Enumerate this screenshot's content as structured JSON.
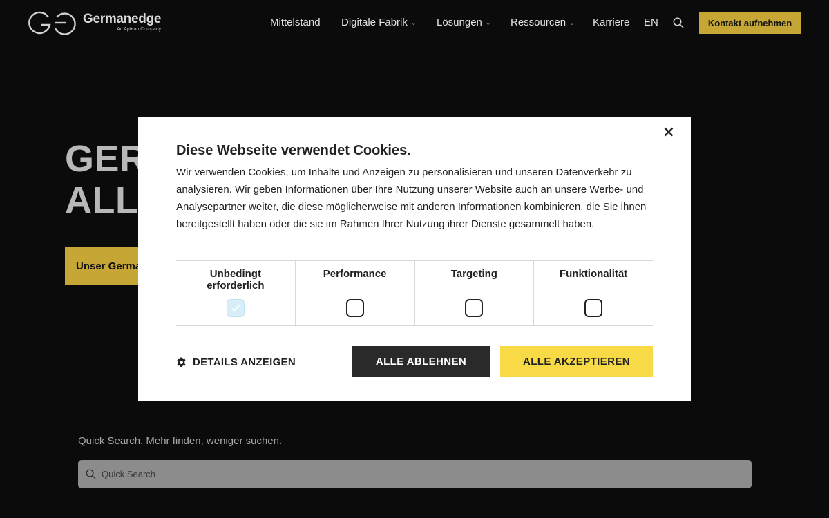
{
  "header": {
    "brand_name": "Germanedge",
    "brand_sub": "An Aptean Company",
    "nav": [
      {
        "label": "Mittelstand",
        "dropdown": false
      },
      {
        "label": "Digitale Fabrik",
        "dropdown": true
      },
      {
        "label": "Lösungen",
        "dropdown": true
      },
      {
        "label": "Ressourcen",
        "dropdown": true
      },
      {
        "label": "Karriere",
        "dropdown": false
      },
      {
        "label": "EN",
        "dropdown": false
      }
    ],
    "contact_label": "Kontakt aufnehmen",
    "accent_color": "#c6a634"
  },
  "hero": {
    "line1": "GER",
    "line2": "ALL",
    "button_label": "Unser Germa"
  },
  "quick_search": {
    "label": "Quick Search. Mehr finden, weniger suchen.",
    "placeholder": "Quick Search"
  },
  "cookie_modal": {
    "title": "Diese Webseite verwendet Cookies.",
    "body": "Wir verwenden Cookies, um Inhalte und Anzeigen zu personalisieren und unseren Datenverkehr zu analysieren. Wir geben Informationen über Ihre Nutzung unserer Website auch an unsere Werbe- und Analysepartner weiter, die diese möglicherweise mit anderen Informationen kombinieren, die Sie ihnen bereitgestellt haben oder die sie im Rahmen Ihrer Nutzung ihrer Dienste gesammelt haben.",
    "categories": [
      {
        "label": "Unbedingt erforderlich",
        "checked": true
      },
      {
        "label": "Performance",
        "checked": false
      },
      {
        "label": "Targeting",
        "checked": false
      },
      {
        "label": "Funktionalität",
        "checked": false
      }
    ],
    "details_label": "DETAILS ANZEIGEN",
    "decline_label": "ALLE ABLEHNEN",
    "accept_label": "ALLE AKZEPTIEREN",
    "accept_color": "#f7da45",
    "decline_color": "#2a2a2a"
  }
}
